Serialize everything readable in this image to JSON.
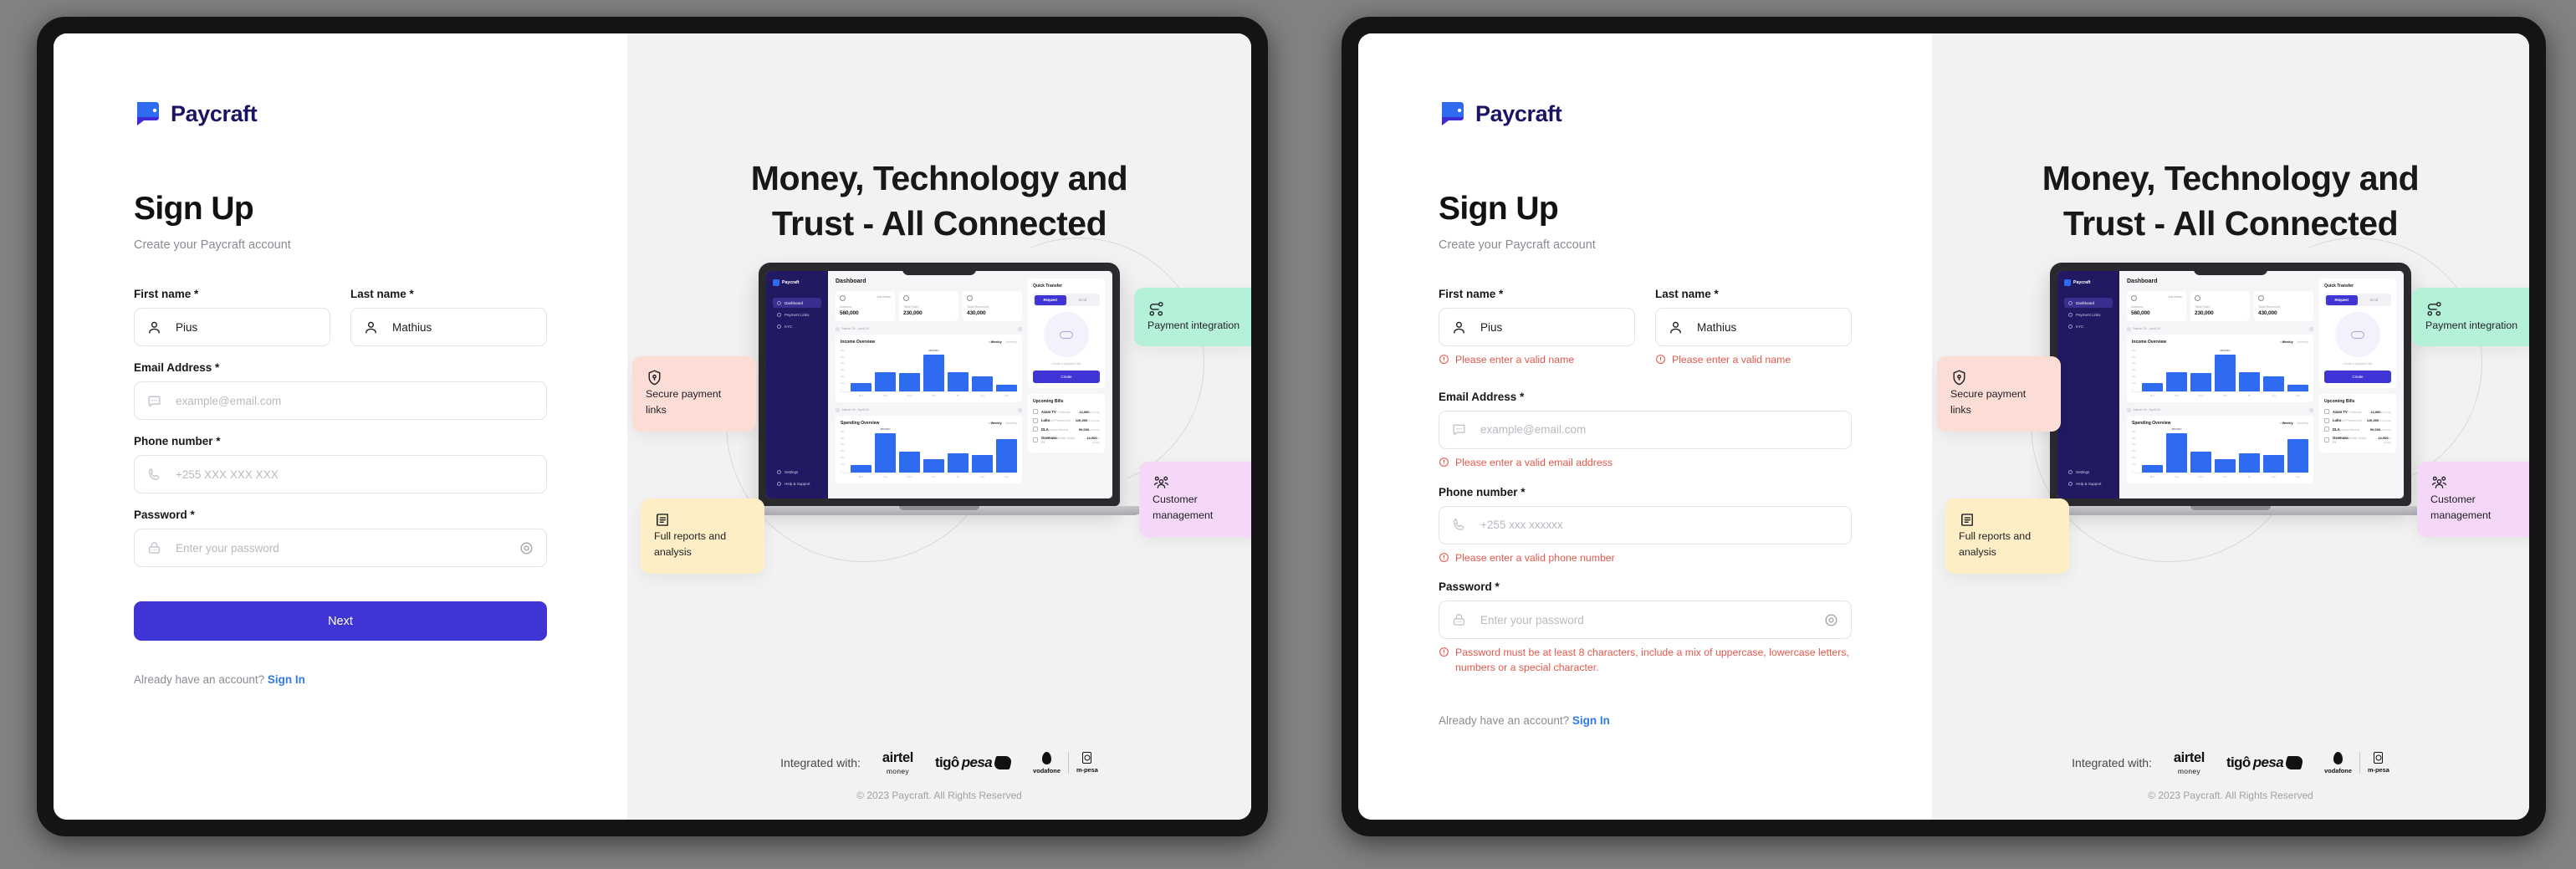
{
  "brand": {
    "name": "Paycraft",
    "accent": "#3f35d4",
    "logo_icon": "paycraft-wallet-logo"
  },
  "form": {
    "title": "Sign Up",
    "subtitle": "Create your Paycraft account",
    "fields": {
      "first_name": {
        "label": "First name *",
        "value": "Pius",
        "icon": "user-icon",
        "error": "Please enter a valid name"
      },
      "last_name": {
        "label": "Last name *",
        "value": "Mathius",
        "icon": "user-icon",
        "error": "Please enter a valid name"
      },
      "email": {
        "label": "Email Address *",
        "placeholder": "example@email.com",
        "icon": "message-icon",
        "error": "Please enter a valid email address"
      },
      "phone": {
        "label": "Phone number *",
        "placeholder": "+255 XXX XXX XXX",
        "placeholder_alt": "+255 xxx xxxxxx",
        "icon": "phone-icon",
        "error": "Please enter a valid phone number"
      },
      "password": {
        "label": "Password *",
        "placeholder": "Enter your password",
        "icon": "lock-icon",
        "toggle_icon": "eye-icon",
        "error": "Password must be at least 8 characters, include a mix of uppercase, lowercase letters, numbers or a special character."
      }
    },
    "submit_label": "Next",
    "signin_prompt": "Already have an account?",
    "signin_link": "Sign In",
    "error_color": "#e2574c"
  },
  "hero": {
    "headline_line1": "Money, Technology and",
    "headline_line2": "Trust - All Connected",
    "cards": [
      {
        "id": "secure",
        "text": "Secure payment links",
        "icon": "shield-lock-icon",
        "color": "#fbddd6"
      },
      {
        "id": "payment",
        "text": "Payment integration",
        "icon": "integration-nodes-icon",
        "color": "#b5f0d9"
      },
      {
        "id": "customer",
        "text": "Customer management",
        "icon": "users-group-icon",
        "color": "#f5d7f7"
      },
      {
        "id": "reports",
        "text": "Full reports and analysis",
        "icon": "report-notebook-icon",
        "color": "#fdeec6"
      }
    ],
    "integrated_label": "Integrated with:",
    "partners": [
      {
        "id": "airtel",
        "name": "airtel",
        "sub": "money"
      },
      {
        "id": "tigopesa",
        "name_a": "tigô",
        "name_b": "pesa"
      },
      {
        "id": "vodafone",
        "name": "vodafone"
      },
      {
        "id": "mpesa",
        "name": "m-pesa"
      }
    ],
    "copyright": "© 2023 Paycraft. All Rights Reserved"
  },
  "dashboard_mock": {
    "brand": "Paycraft",
    "page_title": "Dashboard",
    "nav": [
      "Dashboard",
      "Payment Links",
      "KYC"
    ],
    "nav_bottom": [
      "Settings",
      "Help & Support"
    ],
    "filter_pill": "Ann Nancy",
    "stats": [
      {
        "label": "Balance",
        "value": "560,000"
      },
      {
        "label": "Total Paid",
        "value": "230,000"
      },
      {
        "label": "Total Received",
        "value": "430,000"
      }
    ],
    "date_range": "March 24 - April 24",
    "income_chart": {
      "type": "bar",
      "title": "Income Overview",
      "toggle": [
        "Weekly",
        "Monthly"
      ],
      "toggle_active": "Weekly",
      "categories": [
        "Mon",
        "Tue",
        "Wed",
        "Thu",
        "Fri",
        "Sat",
        "Sun"
      ],
      "values": [
        20,
        45,
        42,
        86,
        45,
        35,
        15
      ],
      "ytick_labels": [
        "60k",
        "50k",
        "40k",
        "30k",
        "20k",
        "10k",
        "0"
      ],
      "peak_label": "254,000/=",
      "peak_index": 3,
      "ylim": [
        0,
        100
      ],
      "bar_color": "#2e6bf0"
    },
    "spending_chart": {
      "type": "bar",
      "title": "Spending Overview",
      "toggle": [
        "Weekly",
        "Monthly"
      ],
      "toggle_active": "Weekly",
      "categories": [
        "Mon",
        "Tue",
        "Wed",
        "Thu",
        "Fri",
        "Sat",
        "Sun"
      ],
      "values": [
        18,
        92,
        48,
        30,
        45,
        40,
        78
      ],
      "ytick_labels": [
        "60k",
        "50k",
        "40k",
        "30k",
        "20k",
        "10k",
        "0"
      ],
      "peak_label": "185,000/=",
      "peak_index": 1,
      "ylim": [
        0,
        100
      ],
      "bar_color": "#2e6bf0"
    },
    "quick_transfer": {
      "title": "Quick Transfer",
      "tabs": [
        "Request",
        "Send"
      ],
      "active_tab": "Request",
      "note": "Create a payment link",
      "button": "Create"
    },
    "upcoming_bills": {
      "title": "Upcoming Bills",
      "rows": [
        {
          "name": "Azam TV",
          "sub": "TV Decoder",
          "amount": "14,000",
          "when": "25 Today"
        },
        {
          "name": "Luku",
          "sub": "Unit Prepaid price",
          "amount": "120,000",
          "when": "24 Sunday"
        },
        {
          "name": "DLA",
          "sub": "Account Monthly",
          "amount": "90,000",
          "when": "23 Friday"
        },
        {
          "name": "Oxemasa",
          "sub": "Monthly Rental Bill",
          "amount": "14,000",
          "when": "22 Friday"
        }
      ]
    }
  }
}
